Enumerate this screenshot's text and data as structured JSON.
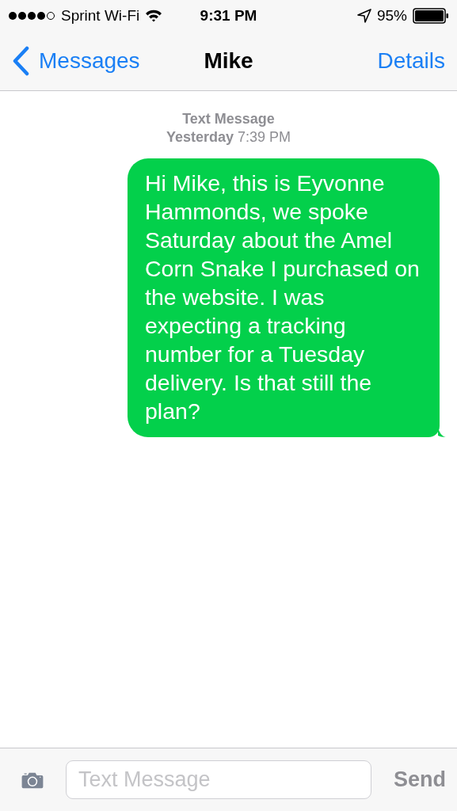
{
  "status_bar": {
    "carrier": "Sprint Wi-Fi",
    "time": "9:31 PM",
    "battery": "95%"
  },
  "nav_bar": {
    "back": "Messages",
    "title": "Mike",
    "action": "Details"
  },
  "thread": {
    "header": "Text Message",
    "timestamp": "**Yesterday** 7:39 PM",
    "messages": [
      {
        "kind": "outgoing",
        "text": "Hi Mike, this is Eyvonne Hammonds, we spoke Saturday about the Amel Corn Snake I purchased on the website. I was expecting a tracking number for a Tuesday delivery. Is that still the plan?"
      }
    ]
  },
  "compose": {
    "placeholder": "Text Message",
    "send": {
      "label": "Send",
      "disabled": true
    }
  }
}
